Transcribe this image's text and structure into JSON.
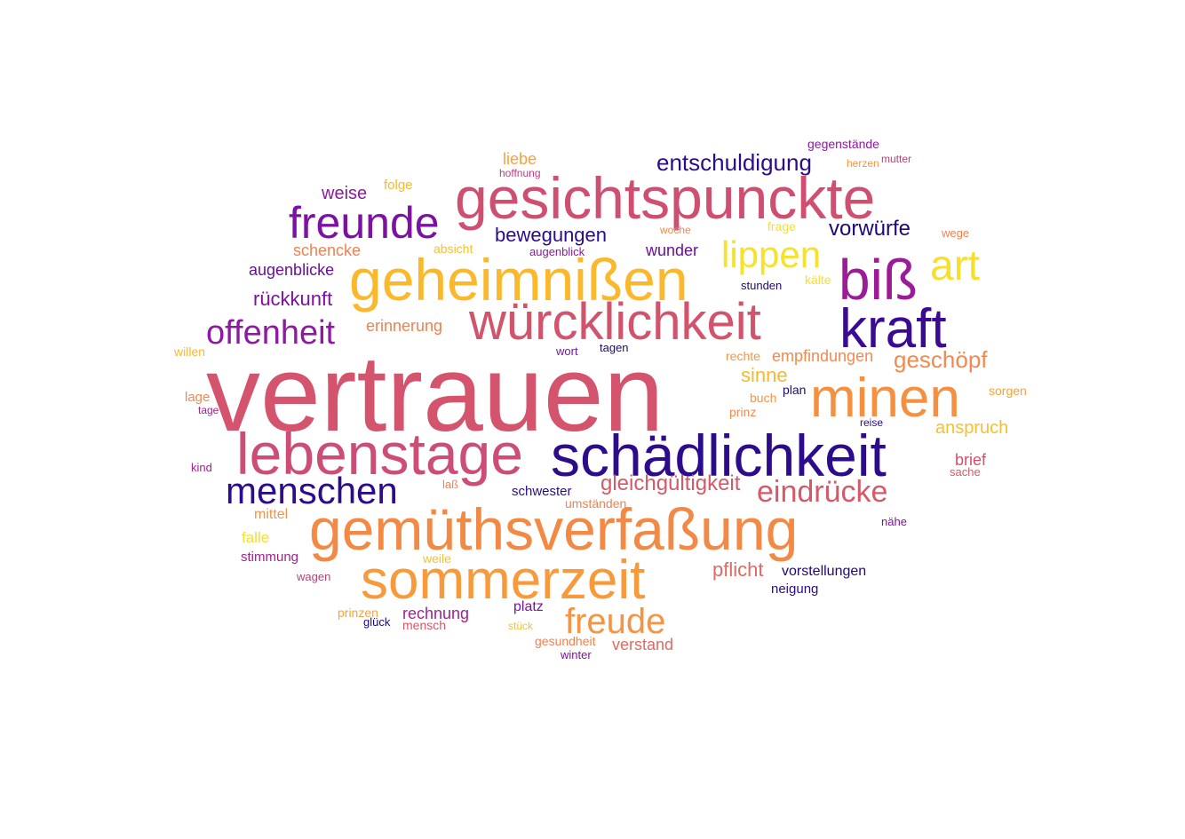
{
  "palette": {
    "deep_blue": "#2a0a8a",
    "navy": "#1a0670",
    "purple": "#7a0fa0",
    "magenta": "#a0228f",
    "rose": "#d0506a",
    "orange": "#f28a40",
    "amber": "#fbb62a",
    "yellow": "#f2e328"
  },
  "words": [
    {
      "text": "vertrauen",
      "color": "#d3546c"
    },
    {
      "text": "gemüthsverfaßung",
      "color": "#f28a45"
    },
    {
      "text": "schädlichkeit",
      "color": "#2c0b8c"
    },
    {
      "text": "gesichtspunckte",
      "color": "#cf4f71"
    },
    {
      "text": "geheimnißen",
      "color": "#fbb82a"
    },
    {
      "text": "lebenstage",
      "color": "#cc4d76"
    },
    {
      "text": "würcklichkeit",
      "color": "#d0546c"
    },
    {
      "text": "sommerzeit",
      "color": "#f69a3c"
    },
    {
      "text": "minen",
      "color": "#f59040"
    },
    {
      "text": "kraft",
      "color": "#3a0a95"
    },
    {
      "text": "biß",
      "color": "#9b1c96"
    },
    {
      "text": "freunde",
      "color": "#7d11a2"
    },
    {
      "text": "art",
      "color": "#f6e02c"
    },
    {
      "text": "lippen",
      "color": "#f4e22c"
    },
    {
      "text": "menschen",
      "color": "#2c0b8c"
    },
    {
      "text": "freude",
      "color": "#f59444"
    },
    {
      "text": "offenheit",
      "color": "#8d1aa0"
    },
    {
      "text": "eindrücke",
      "color": "#d45a68"
    },
    {
      "text": "entschuldigung",
      "color": "#2c0b8c"
    },
    {
      "text": "geschöpf",
      "color": "#f08a50"
    },
    {
      "text": "bewegungen",
      "color": "#2c0b8c"
    },
    {
      "text": "vorwürfe",
      "color": "#1f0878"
    },
    {
      "text": "gleichgültigkeit",
      "color": "#d45a68"
    },
    {
      "text": "rückkunft",
      "color": "#7d11a2"
    },
    {
      "text": "pflicht",
      "color": "#e06a62"
    },
    {
      "text": "anspruch",
      "color": "#f6c030"
    },
    {
      "text": "sinne",
      "color": "#f8b830"
    },
    {
      "text": "weise",
      "color": "#8d1aa0"
    },
    {
      "text": "augenblicke",
      "color": "#6a0ea0"
    },
    {
      "text": "schencke",
      "color": "#f28050"
    },
    {
      "text": "empfindungen",
      "color": "#f08a50"
    },
    {
      "text": "liebe",
      "color": "#f8a23a"
    },
    {
      "text": "rechnung",
      "color": "#a02290"
    },
    {
      "text": "verstand",
      "color": "#e06a62"
    },
    {
      "text": "erinnerung",
      "color": "#f28050"
    },
    {
      "text": "brief",
      "color": "#d0506a"
    },
    {
      "text": "wunder",
      "color": "#6a0ea0"
    },
    {
      "text": "vorstellungen",
      "color": "#1f0878"
    },
    {
      "text": "gegenstände",
      "color": "#8d1aa0"
    },
    {
      "text": "folge",
      "color": "#f8b830"
    },
    {
      "text": "stimmung",
      "color": "#a02290"
    },
    {
      "text": "mittel",
      "color": "#f59444"
    },
    {
      "text": "schwester",
      "color": "#2c0b8c"
    },
    {
      "text": "platz",
      "color": "#7d11a2"
    },
    {
      "text": "neigung",
      "color": "#2c0b8c"
    },
    {
      "text": "falle",
      "color": "#f6e02c"
    },
    {
      "text": "sorgen",
      "color": "#f8a23a"
    },
    {
      "text": "prinz",
      "color": "#f08a50"
    },
    {
      "text": "umständen",
      "color": "#f28050"
    },
    {
      "text": "lage",
      "color": "#f08a50"
    },
    {
      "text": "weile",
      "color": "#f6c030"
    },
    {
      "text": "frage",
      "color": "#f6e02c"
    },
    {
      "text": "wege",
      "color": "#f28050"
    },
    {
      "text": "absicht",
      "color": "#f6c030"
    },
    {
      "text": "kälte",
      "color": "#f6e02c"
    },
    {
      "text": "willen",
      "color": "#f8b830"
    },
    {
      "text": "plan",
      "color": "#1f0878"
    },
    {
      "text": "buch",
      "color": "#f59444"
    },
    {
      "text": "rechte",
      "color": "#f59444"
    },
    {
      "text": "gesundheit",
      "color": "#f28050"
    },
    {
      "text": "prinzen",
      "color": "#f8a23a"
    },
    {
      "text": "mensch",
      "color": "#d45a68"
    },
    {
      "text": "winter",
      "color": "#7d11a2"
    },
    {
      "text": "wagen",
      "color": "#c03a80"
    },
    {
      "text": "laß",
      "color": "#f28050"
    },
    {
      "text": "nähe",
      "color": "#7d11a2"
    },
    {
      "text": "sache",
      "color": "#d45a68"
    },
    {
      "text": "stunden",
      "color": "#1f0878"
    },
    {
      "text": "augenblick",
      "color": "#8d1aa0"
    },
    {
      "text": "hoffnung",
      "color": "#c03a80"
    },
    {
      "text": "herzen",
      "color": "#f59444"
    },
    {
      "text": "mutter",
      "color": "#c03a80"
    },
    {
      "text": "woche",
      "color": "#f08a50"
    },
    {
      "text": "wort",
      "color": "#7d11a2"
    },
    {
      "text": "tagen",
      "color": "#1f0878"
    },
    {
      "text": "kind",
      "color": "#a02290"
    },
    {
      "text": "tage",
      "color": "#a02290"
    },
    {
      "text": "reise",
      "color": "#2c0b8c"
    },
    {
      "text": "glück",
      "color": "#1f0878"
    },
    {
      "text": "stück",
      "color": "#f6c030"
    }
  ]
}
